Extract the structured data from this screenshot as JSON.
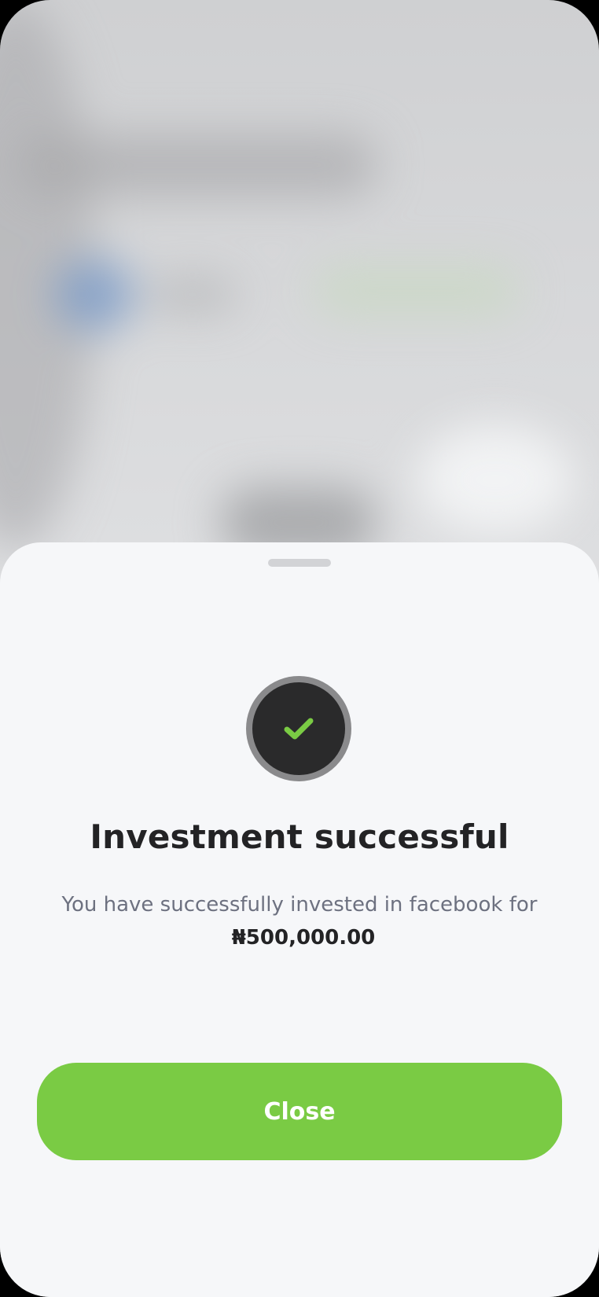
{
  "colors": {
    "accent": "#7acb44",
    "icon_background": "#2a2a2b",
    "icon_ring": "#8a8a8c",
    "sheet_background": "#f6f7f9",
    "title_text": "#232325",
    "body_text": "#6d7180"
  },
  "sheet": {
    "status_icon": "checkmark-icon",
    "title": "Investment successful",
    "message_prefix": "You have successfully invested in facebook for",
    "amount": "₦500,000.00",
    "close_label": "Close"
  }
}
